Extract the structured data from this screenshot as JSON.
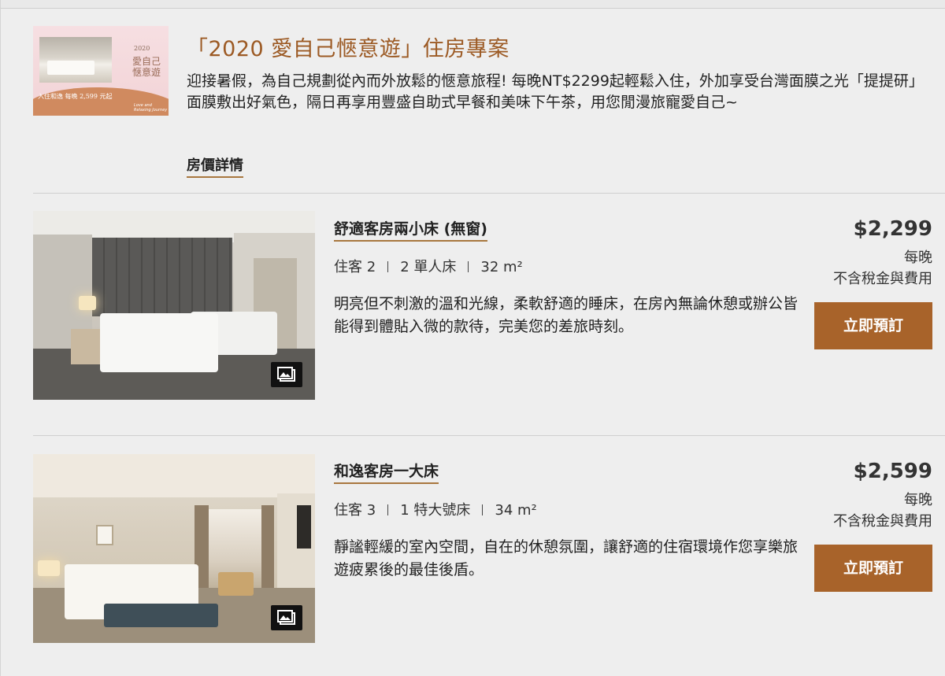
{
  "package": {
    "thumbnail": {
      "year": "2020",
      "title": "愛自己惬意遊",
      "price_text": "入住和逸 每晚 2,599 元起",
      "subtitle": "Love and Relaxing Journey"
    },
    "title": "「2020 愛自己愜意遊」住房專案",
    "description": "迎接暑假，為自己規劃從內而外放鬆的愜意旅程! 每晚NT$2299起輕鬆入住，外加享受台灣面膜之光「提提研」面膜敷出好氣色，隔日再享用豐盛自助式早餐和美味下午茶，用您閒漫旅寵愛自己~",
    "details_link": "房價詳情"
  },
  "rooms": [
    {
      "name": "舒適客房兩小床 (無窗)",
      "guests": "住客 2",
      "beds": "2 單人床",
      "size": "32 m²",
      "description": "明亮但不刺激的溫和光線，柔軟舒適的睡床，在房內無論休憩或辦公皆能得到體貼入微的款待，完美您的差旅時刻。",
      "price": "$2,299",
      "per_night": "每晚",
      "tax_note": "不含稅金與費用",
      "book_label": "立即預訂",
      "photo_icon": "gallery-icon"
    },
    {
      "name": "和逸客房一大床",
      "guests": "住客 3",
      "beds": "1 特大號床",
      "size": "34 m²",
      "description": "靜謐輕緩的室內空間，自在的休憩氛圍，讓舒適的住宿環境作您享樂旅遊疲累後的最佳後盾。",
      "price": "$2,599",
      "per_night": "每晚",
      "tax_note": "不含稅金與費用",
      "book_label": "立即預訂",
      "photo_icon": "gallery-icon"
    }
  ],
  "colors": {
    "brand_title": "#9c5a24",
    "button": "#a8632a",
    "underline": "#a8773f",
    "background": "#eeeeee"
  }
}
